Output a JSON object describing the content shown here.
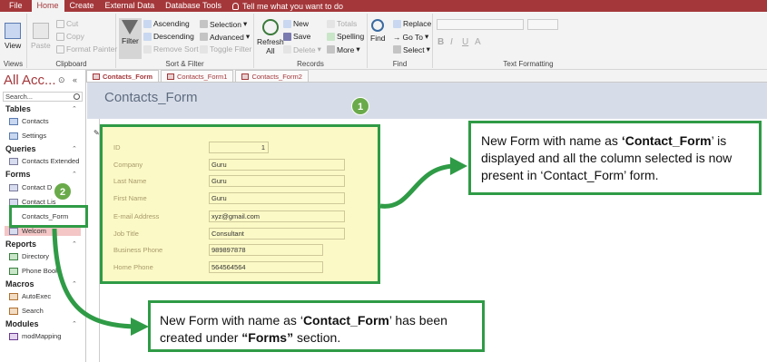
{
  "ribbon_tabs": [
    "File",
    "Home",
    "Create",
    "External Data",
    "Database Tools"
  ],
  "tell_me": "Tell me what you want to do",
  "ribbon": {
    "views": {
      "view": "View",
      "label": "Views"
    },
    "clipboard": {
      "paste": "Paste",
      "cut": "Cut",
      "copy": "Copy",
      "format_painter": "Format Painter",
      "label": "Clipboard"
    },
    "sort_filter": {
      "filter": "Filter",
      "ascending": "Ascending",
      "descending": "Descending",
      "remove_sort": "Remove Sort",
      "selection": "Selection",
      "advanced": "Advanced",
      "toggle_filter": "Toggle Filter",
      "label": "Sort & Filter"
    },
    "records": {
      "refresh": "Refresh",
      "refresh_all": "All",
      "new": "New",
      "save": "Save",
      "delete": "Delete",
      "totals": "Totals",
      "spelling": "Spelling",
      "more": "More",
      "label": "Records"
    },
    "find": {
      "find": "Find",
      "replace": "Replace",
      "goto": "Go To",
      "select": "Select",
      "label": "Find"
    },
    "text_formatting": {
      "bold": "B",
      "italic": "I",
      "underline": "U",
      "font_color": "A",
      "label": "Text Formatting"
    }
  },
  "doc_tabs": [
    "Contacts_Form",
    "Contacts_Form1",
    "Contacts_Form2"
  ],
  "nav": {
    "title": "All Acc...",
    "search_placeholder": "Search...",
    "sections": {
      "tables": "Tables",
      "queries": "Queries",
      "forms": "Forms",
      "reports": "Reports",
      "macros": "Macros",
      "modules": "Modules"
    },
    "tables": [
      "Contacts",
      "Settings"
    ],
    "queries": [
      "Contacts Extended"
    ],
    "forms": [
      "Contact D",
      "Contact Lis",
      "Contacts_Form",
      "Welcom"
    ],
    "reports": [
      "Directory",
      "Phone Book"
    ],
    "macros": [
      "AutoExec",
      "Search"
    ],
    "modules": [
      "modMapping"
    ]
  },
  "form": {
    "title": "Contacts_Form",
    "fields": [
      {
        "label": "ID",
        "value": "1"
      },
      {
        "label": "Company",
        "value": "Guru"
      },
      {
        "label": "Last Name",
        "value": "Guru"
      },
      {
        "label": "First Name",
        "value": "Guru"
      },
      {
        "label": "E-mail Address",
        "value": "xyz@gmail.com"
      },
      {
        "label": "Job Title",
        "value": "Consultant"
      },
      {
        "label": "Business Phone",
        "value": "989897878"
      },
      {
        "label": "Home Phone",
        "value": "564564564"
      }
    ]
  },
  "badges": {
    "one": "1",
    "two": "2"
  },
  "callouts": {
    "right": {
      "pre": "New Form with name as ",
      "bold": "‘Contact_Form",
      "post": "’ is displayed and all the column selected is now present in ‘Contact_Form’ form."
    },
    "bottom": {
      "pre": "New Form with name as ‘",
      "bold1": "Contact_Form",
      "mid": "’ has been created under ",
      "bold2": "“Forms”",
      "post": " section."
    }
  },
  "colors": {
    "accent": "#a4373a",
    "highlight_green": "#2f9b46",
    "form_bg": "#fbf9c5"
  }
}
